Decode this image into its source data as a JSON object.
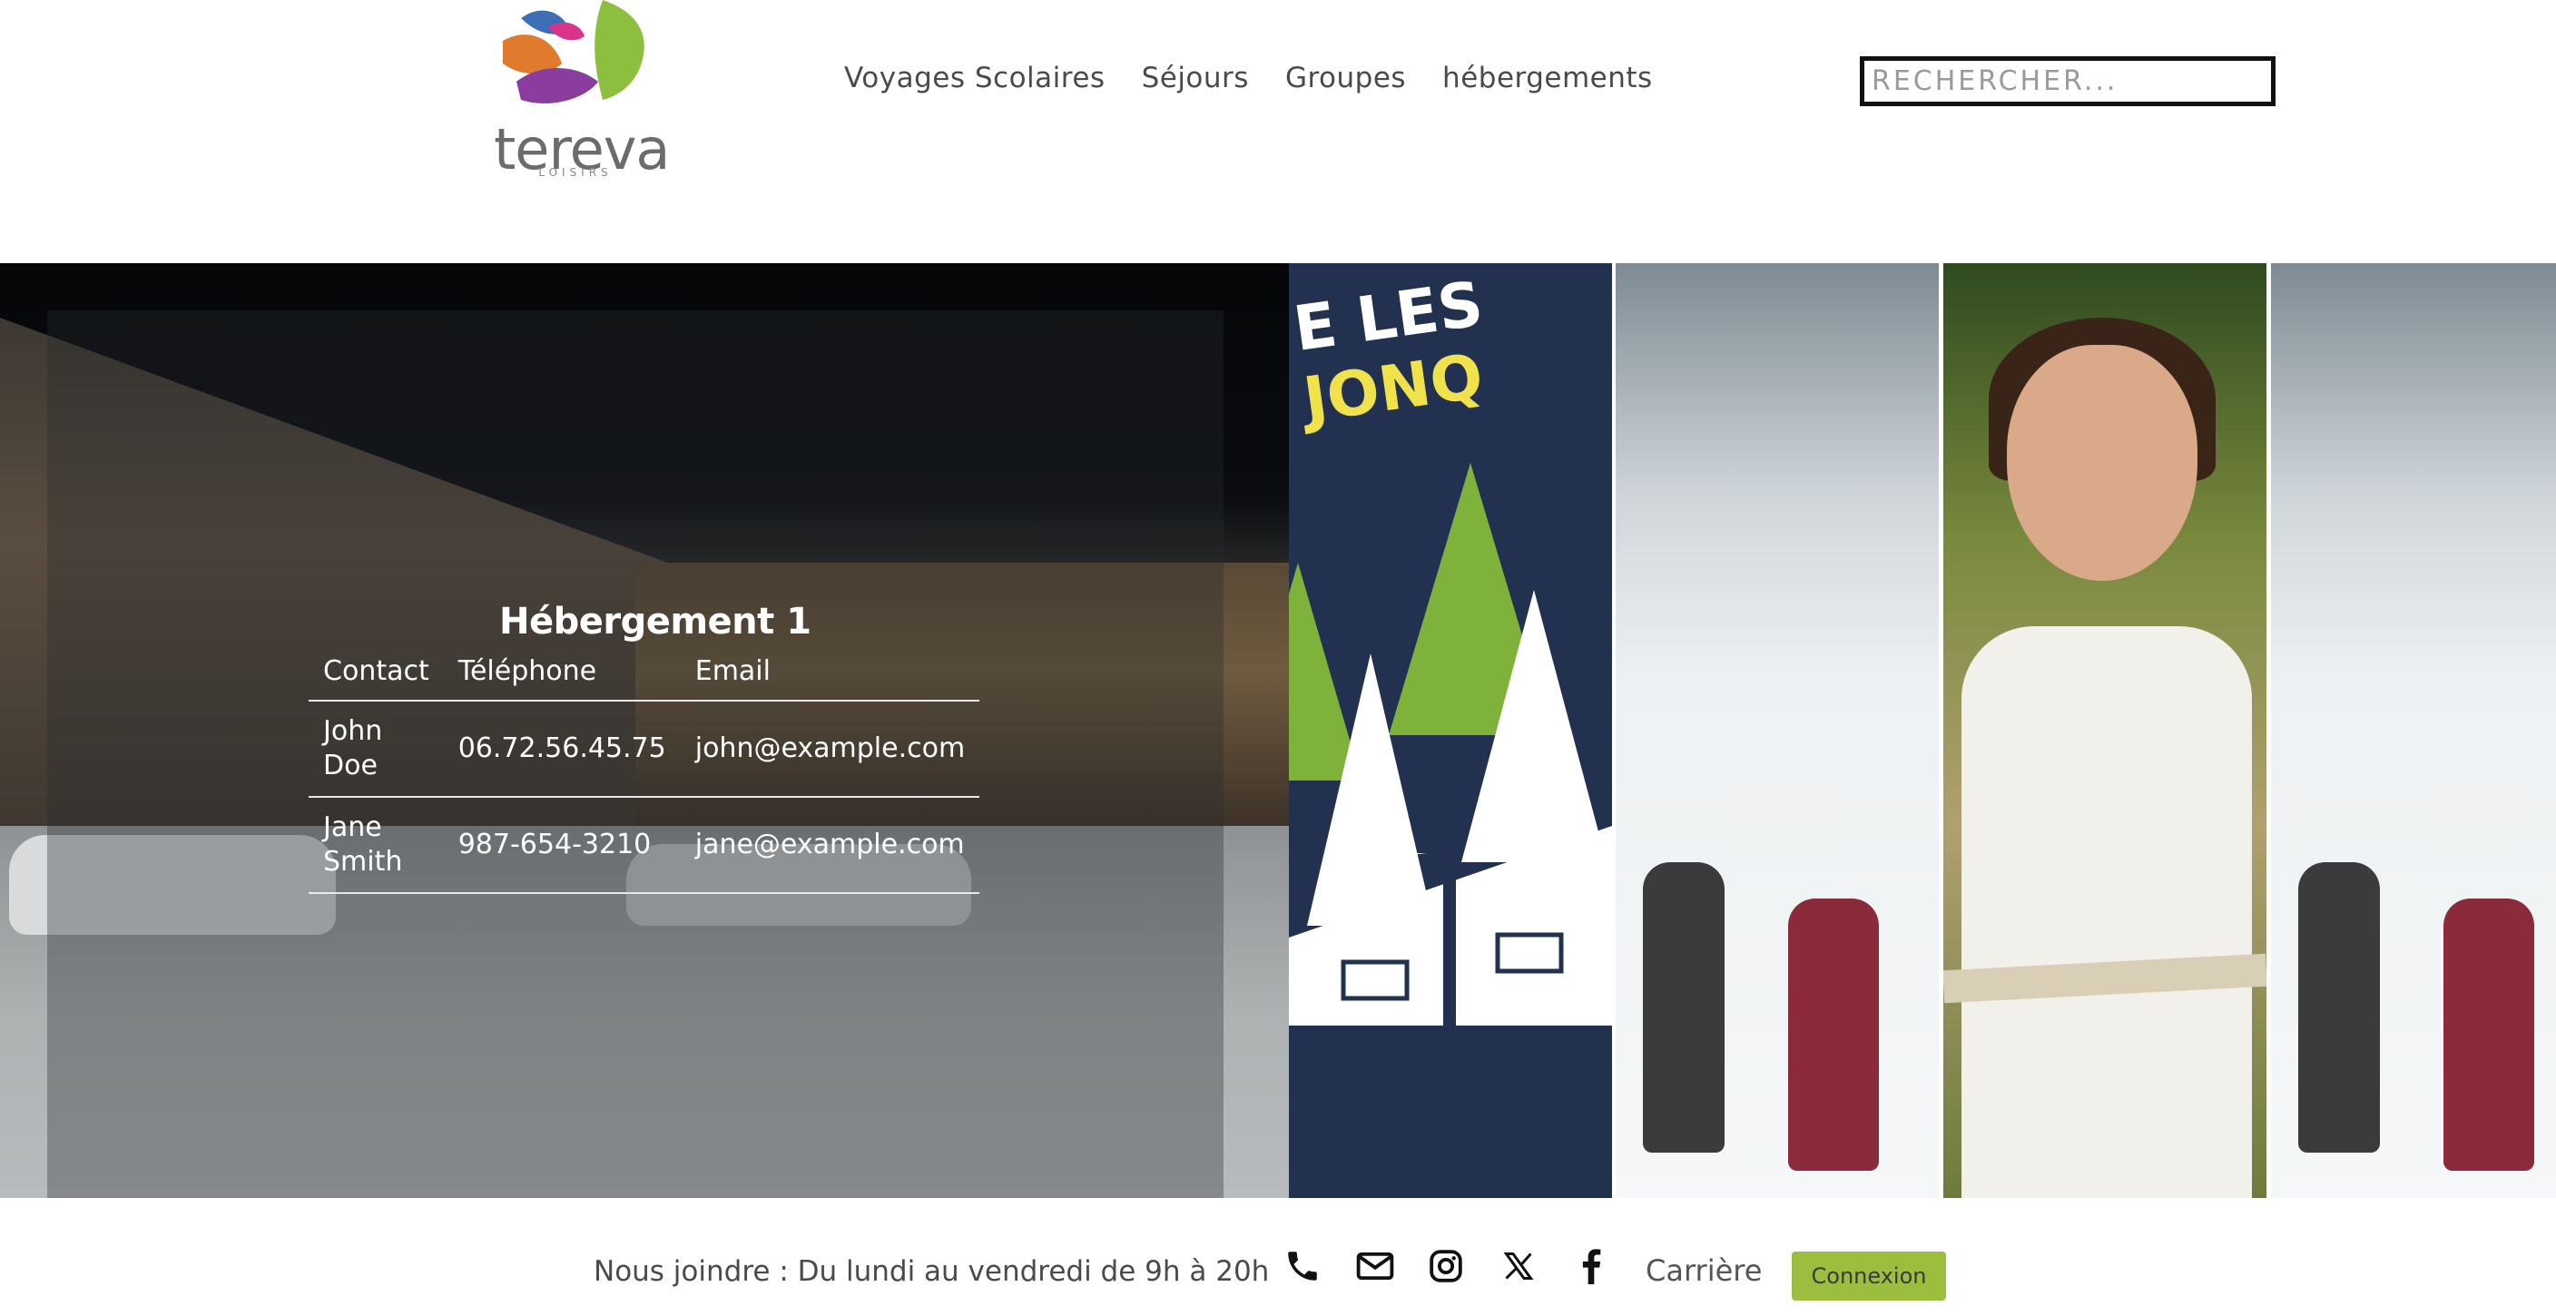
{
  "header": {
    "logo_text": "tereva",
    "logo_subtext": "LOISIRS",
    "nav": [
      "Voyages Scolaires",
      "Séjours",
      "Groupes",
      "hébergements"
    ],
    "search_placeholder": "RECHERCHER..."
  },
  "hero": {
    "panel_text": {
      "les": "E LES ",
      "highlight": "JONQ"
    },
    "card": {
      "title": "Hébergement 1",
      "columns": [
        "Contact",
        "Téléphone",
        "Email"
      ],
      "rows": [
        {
          "contact": "John Doe",
          "phone": "06.72.56.45.75",
          "email": "john@example.com"
        },
        {
          "contact": "Jane Smith",
          "phone": "987-654-3210",
          "email": "jane@example.com"
        }
      ]
    }
  },
  "footer": {
    "contact_text": "Nous joindre : Du lundi au vendredi de 9h à 20h",
    "icons": [
      "phone-icon",
      "mail-icon",
      "instagram-icon",
      "x-icon",
      "facebook-icon"
    ],
    "career_label": "Carrière",
    "login_label": "Connexion"
  },
  "colors": {
    "accent": "#9cbe3e",
    "panel_navy": "#22314f",
    "tree_green": "#7fb23a"
  }
}
